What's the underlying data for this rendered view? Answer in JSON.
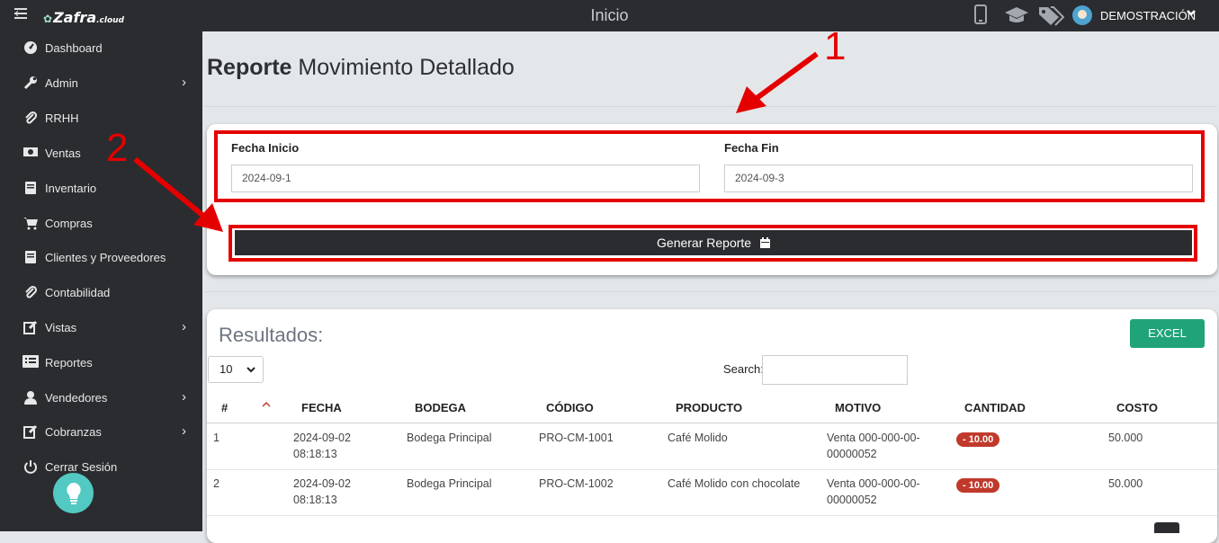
{
  "app": {
    "logo_text": "Zafra",
    "logo_suffix": ".cloud",
    "title": "Inicio",
    "user_name": "DEMOSTRACIÓN",
    "header_icons": [
      "phone-icon",
      "graduation-cap-icon",
      "tags-icon",
      "user-avatar"
    ]
  },
  "sidebar": {
    "items": [
      {
        "label": "Dashboard",
        "icon": "dashboard-icon",
        "has_submenu": false
      },
      {
        "label": "Admin",
        "icon": "wrench-icon",
        "has_submenu": true
      },
      {
        "label": "RRHH",
        "icon": "paperclip-icon",
        "has_submenu": false
      },
      {
        "label": "Ventas",
        "icon": "money-icon",
        "has_submenu": false
      },
      {
        "label": "Inventario",
        "icon": "book-icon",
        "has_submenu": false
      },
      {
        "label": "Compras",
        "icon": "cart-icon",
        "has_submenu": false
      },
      {
        "label": "Clientes y Proveedores",
        "icon": "book-icon",
        "has_submenu": false
      },
      {
        "label": "Contabilidad",
        "icon": "paperclip-icon",
        "has_submenu": false
      },
      {
        "label": "Vistas",
        "icon": "edit-icon",
        "has_submenu": true
      },
      {
        "label": "Reportes",
        "icon": "list-icon",
        "has_submenu": false
      },
      {
        "label": "Vendedores",
        "icon": "user-icon",
        "has_submenu": true
      },
      {
        "label": "Cobranzas",
        "icon": "edit-icon",
        "has_submenu": true
      },
      {
        "label": "Cerrar Sesión",
        "icon": "power-icon",
        "has_submenu": false
      }
    ]
  },
  "page": {
    "title_bold": "Reporte",
    "title_rest": "Movimiento Detallado"
  },
  "filters": {
    "start_label": "Fecha Inicio",
    "start_value": "2024-09-1",
    "end_label": "Fecha Fin",
    "end_value": "2024-09-3",
    "generate_label": "Generar Reporte"
  },
  "annotations": {
    "marker_1": "1",
    "marker_2": "2",
    "color": "#e50000"
  },
  "results": {
    "title": "Resultados:",
    "excel_label": "EXCEL",
    "page_size": "10",
    "search_label": "Search:",
    "columns": [
      "#",
      "FECHA",
      "BODEGA",
      "CÓDIGO",
      "PRODUCTO",
      "MOTIVO",
      "CANTIDAD",
      "COSTO"
    ],
    "rows": [
      {
        "num": "1",
        "fecha": "2024-09-02",
        "hora": "08:18:13",
        "bodega": "Bodega Principal",
        "codigo": "PRO-CM-1001",
        "producto": "Café Molido",
        "motivo1": "Venta 000-000-00-",
        "motivo2": "00000052",
        "cantidad": "- 10.00",
        "costo": "50.000"
      },
      {
        "num": "2",
        "fecha": "2024-09-02",
        "hora": "08:18:13",
        "bodega": "Bodega Principal",
        "codigo": "PRO-CM-1002",
        "producto": "Café Molido con chocolate",
        "motivo1": "Venta 000-000-00-",
        "motivo2": "00000052",
        "cantidad": "- 10.00",
        "costo": "50.000"
      }
    ]
  },
  "colors": {
    "dark": "#2a2c30",
    "excel": "#21a37a",
    "badge": "#c0392b",
    "help_bubble": "#52c9c2"
  }
}
